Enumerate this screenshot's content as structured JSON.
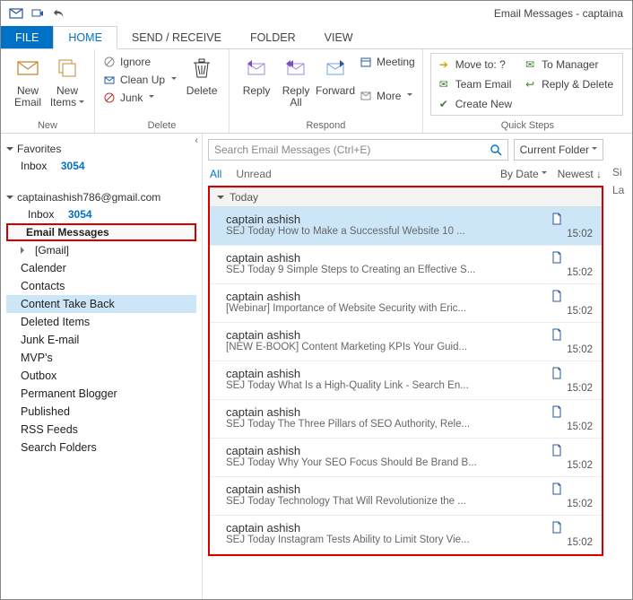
{
  "title": "Email Messages - captaina",
  "tabs": {
    "file": "FILE",
    "home": "HOME",
    "sendreceive": "SEND / RECEIVE",
    "folder": "FOLDER",
    "view": "VIEW"
  },
  "ribbon": {
    "new": {
      "label": "New",
      "newEmail": "New\nEmail",
      "newItems": "New\nItems"
    },
    "delete": {
      "label": "Delete",
      "ignore": "Ignore",
      "cleanup": "Clean Up",
      "junk": "Junk",
      "delete": "Delete"
    },
    "respond": {
      "label": "Respond",
      "reply": "Reply",
      "replyAll": "Reply\nAll",
      "forward": "Forward",
      "meeting": "Meeting",
      "more": "More"
    },
    "quicksteps": {
      "label": "Quick Steps",
      "moveto": "Move to: ?",
      "tomanager": "To Manager",
      "teamemail": "Team Email",
      "replydelete": "Reply & Delete",
      "createnew": "Create New"
    }
  },
  "nav": {
    "favorites": "Favorites",
    "inbox": "Inbox",
    "inboxCount": "3054",
    "account": "captainashish786@gmail.com",
    "emailMessages": "Email Messages",
    "gmail": "[Gmail]",
    "folders": [
      "Calender",
      "Contacts",
      "Content Take Back",
      "Deleted Items",
      "Junk E-mail",
      "MVP's",
      "Outbox",
      "Permanent Blogger",
      "Published",
      "RSS Feeds",
      "Search Folders"
    ]
  },
  "search": {
    "placeholder": "Search Email Messages (Ctrl+E)",
    "scope": "Current Folder"
  },
  "filter": {
    "all": "All",
    "unread": "Unread",
    "bydate": "By Date",
    "newest": "Newest"
  },
  "listGroup": "Today",
  "messages": [
    {
      "from": "captain ashish",
      "subject": "SEJ Today  How to Make a Successful Website  10 ...",
      "time": "15:02",
      "selected": true
    },
    {
      "from": "captain ashish",
      "subject": "SEJ Today  9 Simple Steps to Creating an Effective S...",
      "time": "15:02"
    },
    {
      "from": "captain ashish",
      "subject": "[Webinar] Importance of Website Security with Eric...",
      "time": "15:02"
    },
    {
      "from": "captain ashish",
      "subject": "[NEW E-BOOK] Content Marketing KPIs  Your Guid...",
      "time": "15:02"
    },
    {
      "from": "captain ashish",
      "subject": "SEJ Today   What Is a High-Quality Link  - Search En...",
      "time": "15:02"
    },
    {
      "from": "captain ashish",
      "subject": "SEJ Today  The Three Pillars of SEO  Authority, Rele...",
      "time": "15:02"
    },
    {
      "from": "captain ashish",
      "subject": "SEJ Today  Why Your SEO Focus Should Be Brand B...",
      "time": "15:02"
    },
    {
      "from": "captain ashish",
      "subject": "SEJ Today  Technology That Will Revolutionize the ...",
      "time": "15:02"
    },
    {
      "from": "captain ashish",
      "subject": "SEJ Today  Instagram Tests Ability to Limit Story Vie...",
      "time": "15:02"
    }
  ],
  "preview": {
    "size": "Si",
    "last": "La"
  }
}
